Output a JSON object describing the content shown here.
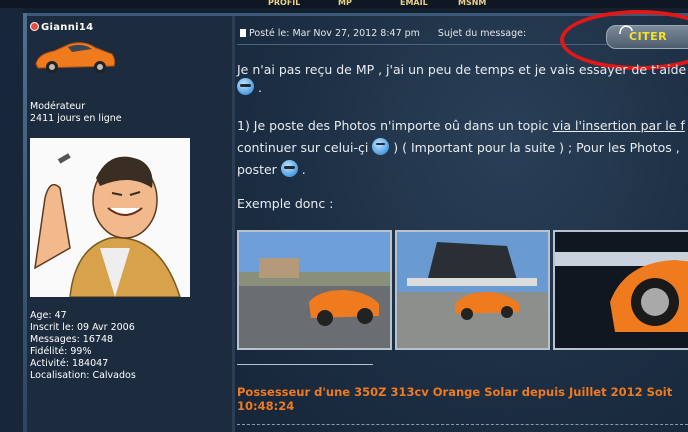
{
  "toolbar": {
    "buttons": [
      "PROFIL",
      "MP",
      "EMAIL",
      "MSNM"
    ]
  },
  "user": {
    "name": "Gianni14",
    "role": "Modérateur",
    "days_online": "2411 jours en ligne",
    "stats": [
      "Age: 47",
      "Inscrit le: 09 Avr 2006",
      "Messages: 16748",
      "Fidélité: 99%",
      "Activité: 184047",
      "Localisation: Calvados"
    ]
  },
  "post": {
    "date": "Posté le: Mar Nov 27, 2012 8:47 pm",
    "subject_label": "Sujet du message:",
    "quote_button": "CITER",
    "lines": {
      "l1": "Je n'ai pas reçu de MP , j'ai un peu de temps et je vais essayer de t'aide",
      "l2_pre": "1) Je poste des Photos n'importe oû dans un topic ",
      "l2_link": "via l'insertion par le f",
      "l3_a": "continuer sur celui-çi",
      "l3_b": " ) ( Important pour la suite ) ; Pour les Photos ,",
      "l4": "poster",
      "l4_end": " .",
      "l5": "Exemple donc :",
      "emoji_end": " ."
    },
    "signature_line1": "Possesseur d'une 350Z 313cv Orange Solar depuis Juillet 2012 Soit",
    "signature_line2": "10:48:24"
  },
  "colors": {
    "accent": "#f07a1e",
    "quote_text": "#f5e12a",
    "highlight_ring": "#e01818"
  }
}
